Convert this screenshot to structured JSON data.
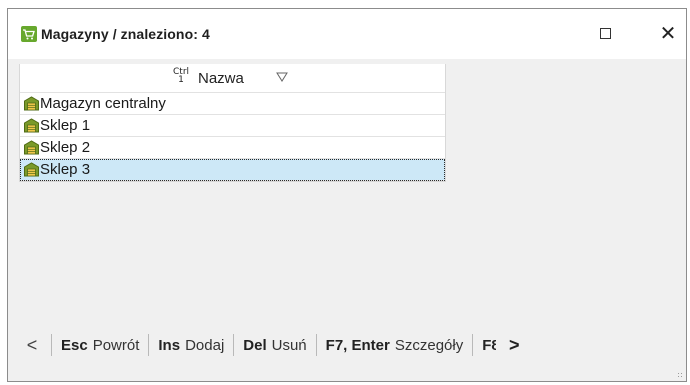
{
  "window": {
    "title": "Magazyny / znaleziono: 4",
    "controls": {
      "maximize_icon": "maximize-icon",
      "close_icon": "close-icon",
      "close_glyph": "✕"
    }
  },
  "grid": {
    "header": {
      "ctrl_hint_top": "Ctrl",
      "ctrl_hint_bottom": "1",
      "column_label": "Nazwa",
      "sort_icon": "sort-descending-icon"
    },
    "rows": [
      {
        "label": "Magazyn centralny",
        "icon": "warehouse-icon",
        "selected": false
      },
      {
        "label": "Sklep 1",
        "icon": "warehouse-icon",
        "selected": false
      },
      {
        "label": "Sklep 2",
        "icon": "warehouse-icon",
        "selected": false
      },
      {
        "label": "Sklep 3",
        "icon": "warehouse-icon",
        "selected": true
      }
    ]
  },
  "footer": {
    "prev_glyph": "<",
    "actions": [
      {
        "key": "Esc",
        "label": "Powrót"
      },
      {
        "key": "Ins",
        "label": "Dodaj"
      },
      {
        "key": "Del",
        "label": "Usuń"
      },
      {
        "key": "F7, Enter",
        "label": "Szczegóły"
      }
    ],
    "truncated_key": "F8",
    "next_glyph": ">"
  },
  "colors": {
    "app_icon": "#67a82d",
    "selection": "#cde8f7",
    "warehouse_icon_fill": "#7a9a2a",
    "warehouse_icon_door": "#f2c84b"
  }
}
